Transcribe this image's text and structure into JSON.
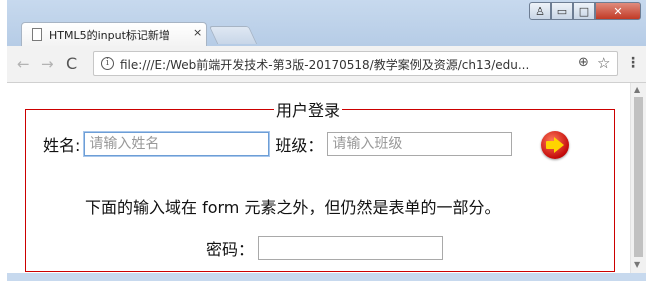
{
  "browser": {
    "tab_title": "HTML5的input标记新增",
    "tab_close": "×",
    "url": "file:///E:/Web前端开发技术-第3版-20170518/教学案例及资源/ch13/edu...",
    "nav_back": "←",
    "nav_forward": "→",
    "reload": "C",
    "info": "i",
    "zoom": "⊕",
    "star": "☆",
    "menu": "⋮",
    "window_controls": {
      "user": "♙",
      "minimize": "▭",
      "maximize": "□",
      "close": "✕"
    }
  },
  "page": {
    "legend": "用户登录",
    "name_label": "姓名:",
    "name_placeholder": "请输入姓名",
    "class_label": "班级：",
    "class_placeholder": "请输入班级",
    "note": "下面的输入域在 form 元素之外，但仍然是表单的一部分。",
    "password_label": "密码：",
    "password_placeholder": ""
  },
  "scrollbar": {
    "up": "▲",
    "down": "▼"
  },
  "colors": {
    "fieldset_border": "#cc0000",
    "submit_button": "#c40a0a",
    "arrow": "#ffd400"
  },
  "icons": [
    "page-icon",
    "info-icon",
    "zoom-icon",
    "star-icon",
    "menu-icon",
    "submit-arrow-icon"
  ]
}
